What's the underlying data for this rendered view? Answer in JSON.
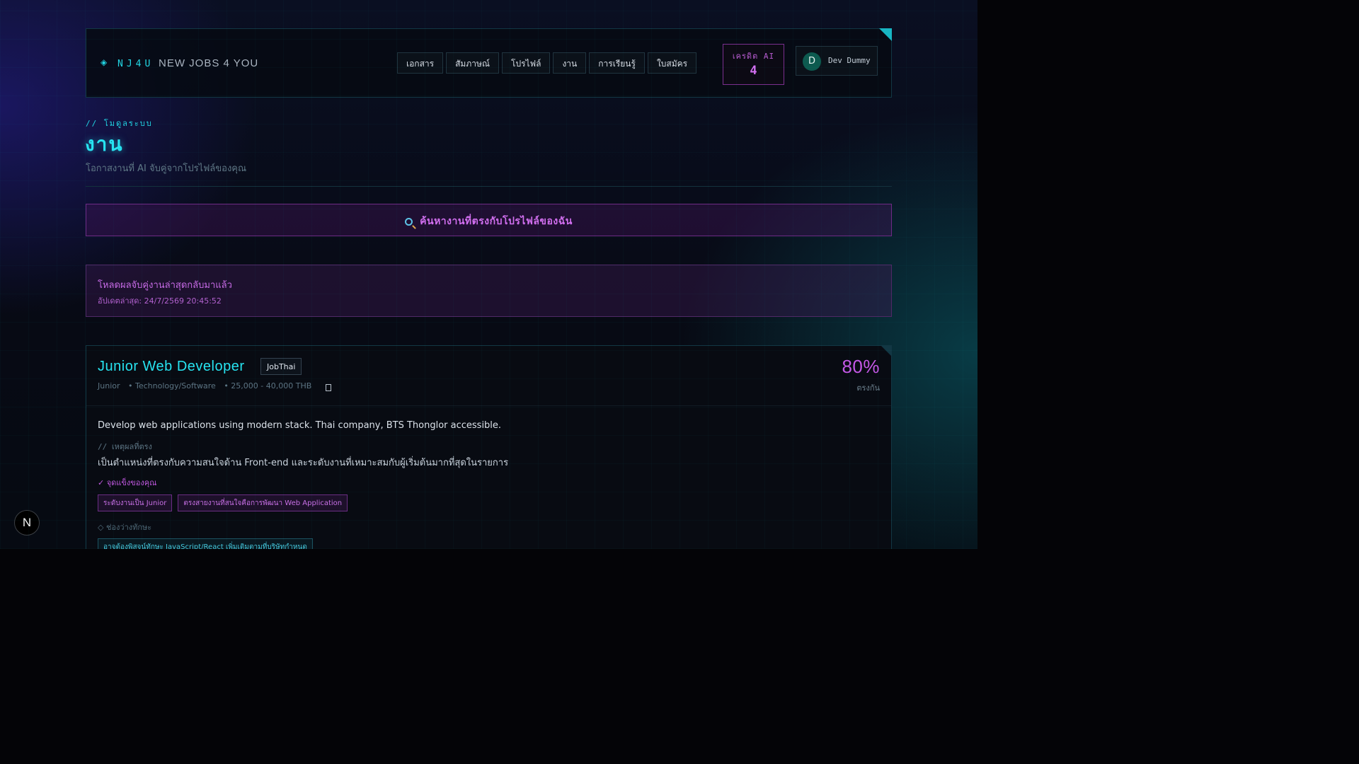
{
  "brand": {
    "abbr": "NJ4U",
    "name": "NEW JOBS 4 YOU",
    "mark": "◈"
  },
  "nav": [
    "เอกสาร",
    "สัมภาษณ์",
    "โปรไฟล์",
    "งาน",
    "การเรียนรู้",
    "ใบสมัคร"
  ],
  "credits": {
    "label": "เครดิต AI",
    "value": "4"
  },
  "user": {
    "initial": "D",
    "name": "Dev Dummy"
  },
  "page": {
    "eyebrow": "// โมดูลระบบ",
    "title": "งาน",
    "subtitle": "โอกาสงานที่ AI จับคู่จากโปรไฟล์ของคุณ"
  },
  "search": {
    "label": "ค้นหางานที่ตรงกับโปรไฟล์ของฉัน"
  },
  "notice": {
    "title": "โหลดผลจับคู่งานล่าสุดกลับมาแล้ว",
    "updated": "อัปเดตล่าสุด: 24/7/2569 20:45:52"
  },
  "job": {
    "title": "Junior Web Developer",
    "source": "JobThai",
    "level": "Junior",
    "industry": "• Technology/Software",
    "salary": "• 25,000 - 40,000 THB",
    "match_percent": "80%",
    "match_label": "ตรงกัน",
    "description": "Develop web applications using modern stack. Thai company, BTS Thonglor accessible.",
    "reason_label": "// เหตุผลที่ตรง",
    "reason": "เป็นตำแหน่งที่ตรงกับความสนใจด้าน Front-end และระดับงานที่เหมาะสมกับผู้เริ่มต้นมากที่สุดในรายการ",
    "strengths_label": "✓ จุดแข็งของคุณ",
    "strengths": [
      "ระดับงานเป็น Junior",
      "ตรงสายงานที่สนใจคือการพัฒนา Web Application"
    ],
    "gaps_label": "◇ ช่องว่างทักษะ",
    "gaps": [
      "อาจต้องพิสูจน์ทักษะ JavaScript/React เพิ่มเติมตามที่บริษัทกำหนด"
    ]
  },
  "floating": {
    "label": "N"
  }
}
